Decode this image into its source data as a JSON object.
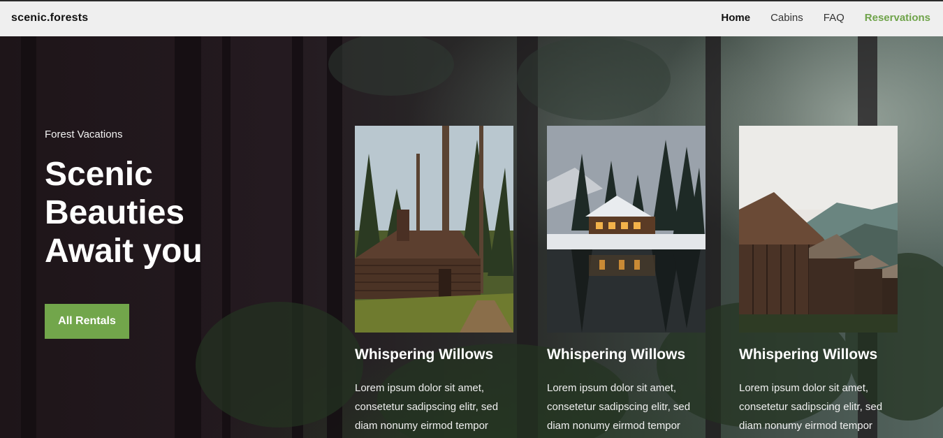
{
  "brand": "scenic.forests",
  "nav": {
    "items": [
      {
        "label": "Home"
      },
      {
        "label": "Cabins"
      },
      {
        "label": "FAQ"
      },
      {
        "label": "Reservations"
      }
    ]
  },
  "hero": {
    "eyebrow": "Forest Vacations",
    "headline": "Scenic Beauties Await you",
    "cta_label": "All Rentals"
  },
  "cards": [
    {
      "title": "Whispering Willows",
      "text": "Lorem ipsum dolor sit amet, consetetur sadipscing elitr, sed diam nonumy eirmod tempor"
    },
    {
      "title": "Whispering Willows",
      "text": "Lorem ipsum dolor sit amet, consetetur sadipscing elitr, sed diam nonumy eirmod tempor"
    },
    {
      "title": "Whispering Willows",
      "text": "Lorem ipsum dolor sit amet, consetetur sadipscing elitr, sed diam nonumy eirmod tempor"
    }
  ],
  "colors": {
    "accent": "#72a64b",
    "nav_bg": "#efefef",
    "hero_dark": "#1e1519"
  }
}
